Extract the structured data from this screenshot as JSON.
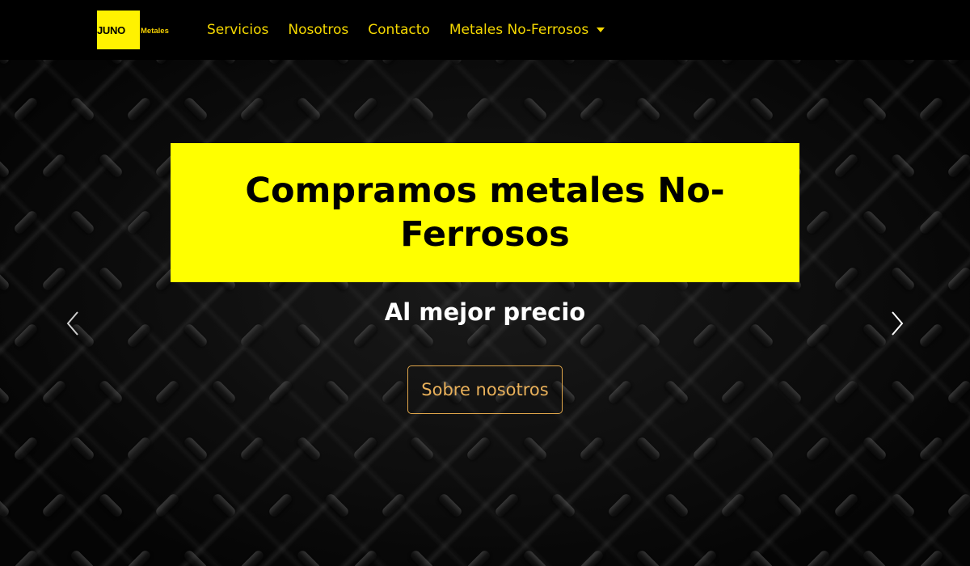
{
  "brand": {
    "logo_text_primary": "JUNO",
    "logo_text_secondary": "Metales",
    "logo_bg_color": "#fff200",
    "logo_text_color": "#000000",
    "logo_secondary_color": "#f5d000"
  },
  "nav": {
    "items": [
      {
        "label": "Servicios"
      },
      {
        "label": "Nosotros"
      },
      {
        "label": "Contacto"
      },
      {
        "label": "Metales No-Ferrosos",
        "has_dropdown": true
      }
    ],
    "link_color": "#f5d800",
    "background": "#000000"
  },
  "hero": {
    "headline": "Compramos metales No-Ferrosos",
    "headline_bg_color": "#ffff00",
    "subtitle": "Al mejor precio",
    "cta_label": "Sobre nosotros",
    "cta_border_color": "#e0a64a",
    "prev_icon": "chevron-left-icon",
    "next_icon": "chevron-right-icon"
  }
}
